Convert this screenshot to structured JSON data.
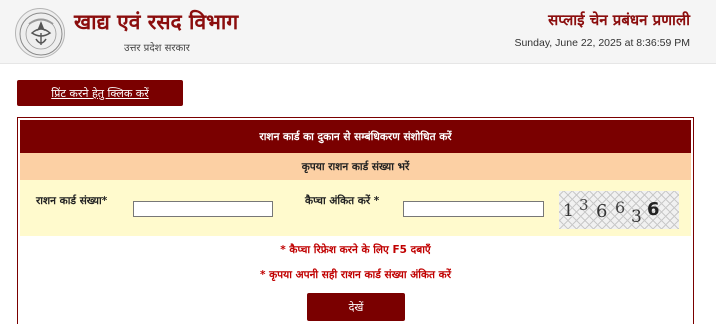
{
  "header": {
    "department_title": "खाद्य एवं रसद विभाग",
    "government": "उत्तर प्रदेश सरकार",
    "system_title": "सप्लाई चेन प्रबंधन प्रणाली",
    "datetime": "Sunday, June 22, 2025 at 8:36:59 PM",
    "logo_icon": "up-govt-emblem-icon"
  },
  "print_button": {
    "label": "प्रिंट करने हेतु क्लिक करें"
  },
  "form": {
    "heading": "राशन कार्ड का दुकान से सम्बंधिकरण संशोधित करें",
    "subheading": "कृपया राशन कार्ड संख्या भरें",
    "ration_card_label": "राशन कार्ड संख्या*",
    "ration_card_value": "",
    "captcha_label": "कैप्चा अंकित करें *",
    "captcha_value": "",
    "captcha_digits": [
      "1",
      "3",
      "6",
      "6",
      "3",
      "6"
    ],
    "note_refresh": "* कैप्चा रिफ्रेश करने के लिए F5 दबाएँ",
    "note_correct": "* कृपया अपनी सही राशन कार्ड संख्या अंकित करें",
    "view_button": "देखें"
  },
  "colors": {
    "brand": "#7a0000",
    "title": "#8b0d0d",
    "subheader_bg": "#fcd0a4",
    "row_bg": "#fffacd",
    "note": "#c00000"
  }
}
